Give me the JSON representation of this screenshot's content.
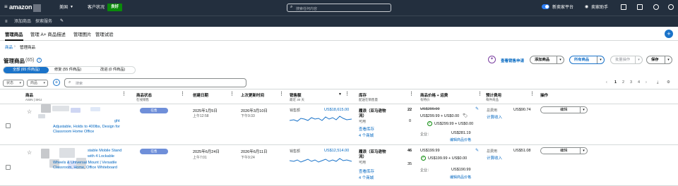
{
  "topnav": {
    "logo": "amazon",
    "marketplace": "美国",
    "account_health": "客户状况",
    "health_badge": "良好",
    "search_placeholder": "搜索任何内容",
    "new_platform": "新卖家平台",
    "seller_assist": "卖家助手"
  },
  "subnav": {
    "items": [
      "添加商品",
      "探索服务"
    ]
  },
  "tabs": [
    "管理商品",
    "管理 A+ 商品描述",
    "管理图片",
    "管理试验"
  ],
  "breadcrumb": {
    "root": "商品",
    "current": "管理商品"
  },
  "page": {
    "title": "管理商品",
    "count": "(65)",
    "view_sales_link": "查看销售申请",
    "add_product": "添加商品",
    "all_products": "所有商品",
    "bulk_actions": "批量操作",
    "save": "保存"
  },
  "segments": [
    "全部 (65 件商品)",
    "修复 (55 件商品)",
    "改进 (0 件商品)"
  ],
  "filters": {
    "status": "状态",
    "sort": "商品",
    "search_placeholder": "搜索"
  },
  "pagination": [
    "1",
    "2",
    "3",
    "4"
  ],
  "columns": [
    {
      "title": "商品",
      "sub": "ASIN | SKU"
    },
    {
      "title": "商品状态",
      "sub": "在线销售"
    },
    {
      "title": "创建日期",
      "sub": ""
    },
    {
      "title": "上次更新时间",
      "sub": ""
    },
    {
      "title": "销售额",
      "sub": "最近 30 天"
    },
    {
      "title": "库存",
      "sub": "配送在销售量"
    },
    {
      "title": "商品价格 + 运费",
      "sub": "有特价"
    },
    {
      "title": "预计费用",
      "sub": "每件商品"
    },
    {
      "title": "操作",
      "sub": ""
    }
  ],
  "rows": [
    {
      "title_lines": [
        "ght",
        "Adjustable, Holds to 400lbs, Design for",
        "Classroom Home Office"
      ],
      "status": "在售",
      "created_date": "2025年1月5日",
      "created_time": "上午12:58",
      "updated_date": "2026年3月10日",
      "updated_time": "下午9:33",
      "sales_label": "销售额",
      "sales_value": "US$18,615.00",
      "fulfillment": [
        "履浪（亚马逊物",
        "流）"
      ],
      "available_label": "可用",
      "inventory_qty": "22",
      "available_qty": "0",
      "view_inventory": "查看库存",
      "shipments": "4 个商城",
      "list_price": "US$299.99",
      "price_line": "US$299.99 + US$0.00",
      "featured_price": "US$299.99 + US$0.00",
      "business_label": "企业：",
      "business_price": "US$281.19",
      "edit_price": "编辑商品价格",
      "fee_total_label": "总费用",
      "fee_total": "US$90.74",
      "fee_link": "计算收入",
      "action": "编辑"
    },
    {
      "title_lines": [
        "stable Mobile Stand",
        "with 4 Lockable",
        "Wheels & Universal Mount | Versatile",
        "Classroom, Home, Office Whiteboard"
      ],
      "status": "在售",
      "created_date": "2025年6月24日",
      "created_time": "上午7:01",
      "updated_date": "2026年6月11日",
      "updated_time": "下午9:24",
      "sales_label": "销售额",
      "sales_value": "US$12,514.00",
      "fulfillment": [
        "履浪（亚马逊物",
        "流）"
      ],
      "available_label": "可用",
      "inventory_qty": "46",
      "available_qty": "35",
      "view_inventory": "查看库存",
      "shipments": "4 个商城",
      "list_price": "US$199.99",
      "price_line": "US$199.99 + US$0.00",
      "featured_price": "",
      "business_label": "企业：",
      "business_price": "US$190.99",
      "edit_price": "编辑商品价格",
      "fee_total_label": "总费用",
      "fee_total": "US$51.08",
      "fee_link": "计算收入",
      "action": "编辑"
    }
  ],
  "colors": {
    "nav": "#232f3e",
    "accent": "#1a73c9",
    "badge": "#6f8fd9",
    "healthy": "#0a8a0a"
  }
}
